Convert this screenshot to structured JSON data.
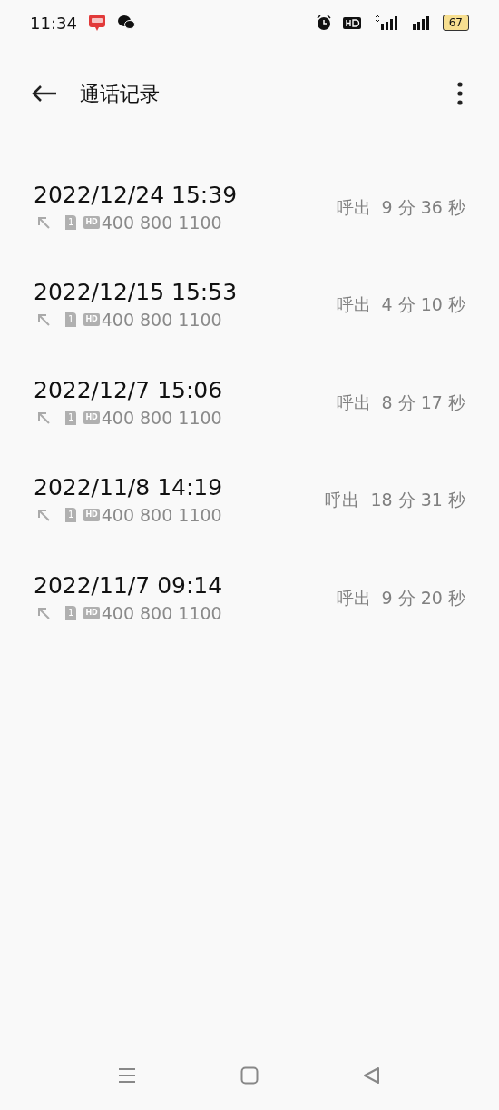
{
  "status_bar": {
    "time": "11:34",
    "battery": "67"
  },
  "header": {
    "title": "通话记录"
  },
  "calls": [
    {
      "datetime": "2022/12/24 15:39",
      "sim_slot": "1",
      "hd_label": "HD",
      "number": "400 800 1100",
      "summary": "呼出  9 分 36 秒"
    },
    {
      "datetime": "2022/12/15 15:53",
      "sim_slot": "1",
      "hd_label": "HD",
      "number": "400 800 1100",
      "summary": "呼出  4 分 10 秒"
    },
    {
      "datetime": "2022/12/7 15:06",
      "sim_slot": "1",
      "hd_label": "HD",
      "number": "400 800 1100",
      "summary": "呼出  8 分 17 秒"
    },
    {
      "datetime": "2022/11/8 14:19",
      "sim_slot": "1",
      "hd_label": "HD",
      "number": "400 800 1100",
      "summary": "呼出  18 分 31 秒"
    },
    {
      "datetime": "2022/11/7 09:14",
      "sim_slot": "1",
      "hd_label": "HD",
      "number": "400 800 1100",
      "summary": "呼出  9 分 20 秒"
    }
  ]
}
